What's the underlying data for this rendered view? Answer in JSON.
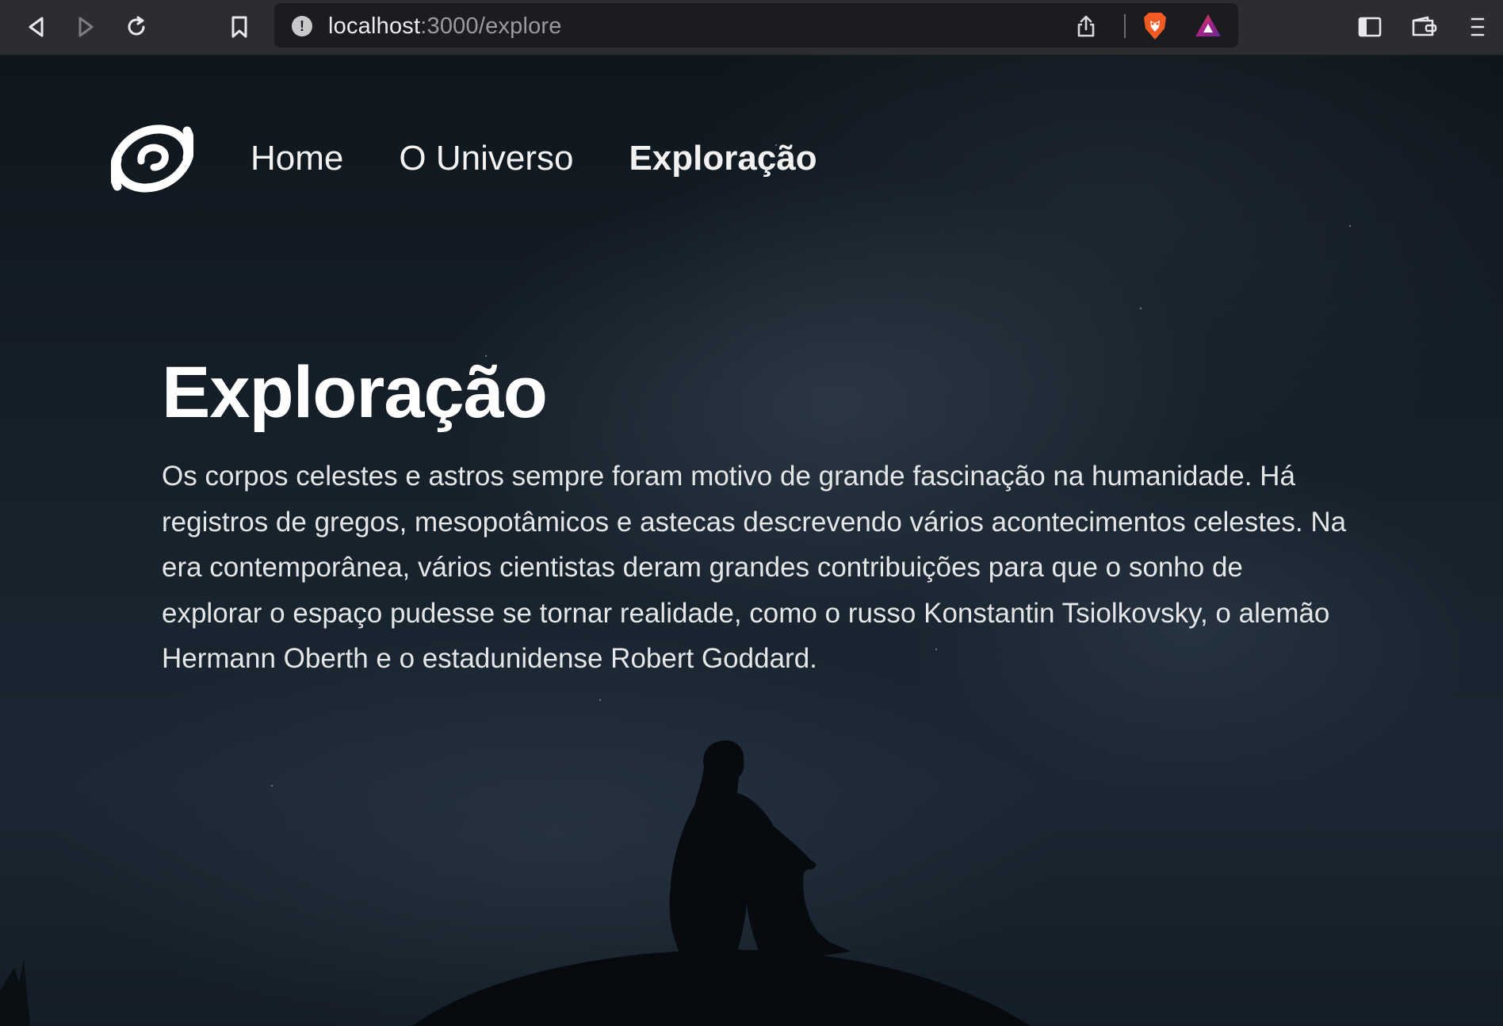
{
  "browser": {
    "url_host": "localhost",
    "url_path": ":3000/explore",
    "buttons": {
      "back": "back-icon",
      "forward": "forward-icon",
      "reload": "reload-icon",
      "bookmark": "bookmark-icon",
      "share": "share-icon",
      "brave_shields": "brave-lion-icon",
      "rewards": "rewards-triangle-icon",
      "sidebar": "sidebar-icon",
      "wallet": "wallet-icon",
      "menu": "menu-icon"
    }
  },
  "nav": {
    "items": [
      {
        "label": "Home"
      },
      {
        "label": "O Universo"
      },
      {
        "label": "Exploração"
      }
    ],
    "active": "Exploração"
  },
  "main": {
    "title": "Exploração",
    "body": "Os corpos celestes e astros sempre foram motivo de grande fascinação na humanidade. Há registros de gregos, mesopotâmicos e astecas descrevendo vários acontecimentos celestes. Na era contemporânea, vários cientistas deram grandes contribuições para que o sonho de explorar o espaço pudesse se tornar realidade, como o russo Konstantin Tsiolkovsky, o alemão Hermann Oberth e o estadunidense Robert Goddard."
  },
  "colors": {
    "chrome_bg": "#2b2d31",
    "urlbar_bg": "#1b1c1f",
    "page_bg": "#16212b",
    "text": "#f2f2f2",
    "brave_orange": "#f15a22"
  }
}
